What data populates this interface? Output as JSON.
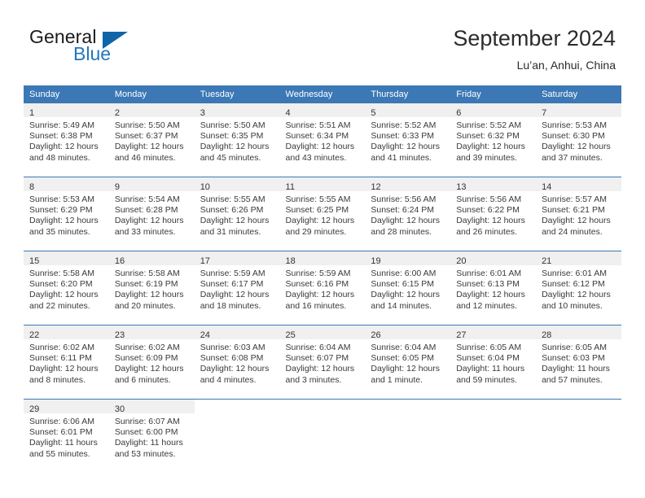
{
  "brand": {
    "name_part1": "General",
    "name_part2": "Blue",
    "logo_icon": "triangle-logo-icon"
  },
  "header": {
    "title": "September 2024",
    "location": "Lu’an, Anhui, China"
  },
  "calendar": {
    "weekday_headers": [
      "Sunday",
      "Monday",
      "Tuesday",
      "Wednesday",
      "Thursday",
      "Friday",
      "Saturday"
    ],
    "accent_color": "#3b78b5",
    "daynum_band_color": "#f0f0f0",
    "weeks": [
      [
        {
          "day": "1",
          "sunrise": "Sunrise: 5:49 AM",
          "sunset": "Sunset: 6:38 PM",
          "daylight1": "Daylight: 12 hours",
          "daylight2": "and 48 minutes."
        },
        {
          "day": "2",
          "sunrise": "Sunrise: 5:50 AM",
          "sunset": "Sunset: 6:37 PM",
          "daylight1": "Daylight: 12 hours",
          "daylight2": "and 46 minutes."
        },
        {
          "day": "3",
          "sunrise": "Sunrise: 5:50 AM",
          "sunset": "Sunset: 6:35 PM",
          "daylight1": "Daylight: 12 hours",
          "daylight2": "and 45 minutes."
        },
        {
          "day": "4",
          "sunrise": "Sunrise: 5:51 AM",
          "sunset": "Sunset: 6:34 PM",
          "daylight1": "Daylight: 12 hours",
          "daylight2": "and 43 minutes."
        },
        {
          "day": "5",
          "sunrise": "Sunrise: 5:52 AM",
          "sunset": "Sunset: 6:33 PM",
          "daylight1": "Daylight: 12 hours",
          "daylight2": "and 41 minutes."
        },
        {
          "day": "6",
          "sunrise": "Sunrise: 5:52 AM",
          "sunset": "Sunset: 6:32 PM",
          "daylight1": "Daylight: 12 hours",
          "daylight2": "and 39 minutes."
        },
        {
          "day": "7",
          "sunrise": "Sunrise: 5:53 AM",
          "sunset": "Sunset: 6:30 PM",
          "daylight1": "Daylight: 12 hours",
          "daylight2": "and 37 minutes."
        }
      ],
      [
        {
          "day": "8",
          "sunrise": "Sunrise: 5:53 AM",
          "sunset": "Sunset: 6:29 PM",
          "daylight1": "Daylight: 12 hours",
          "daylight2": "and 35 minutes."
        },
        {
          "day": "9",
          "sunrise": "Sunrise: 5:54 AM",
          "sunset": "Sunset: 6:28 PM",
          "daylight1": "Daylight: 12 hours",
          "daylight2": "and 33 minutes."
        },
        {
          "day": "10",
          "sunrise": "Sunrise: 5:55 AM",
          "sunset": "Sunset: 6:26 PM",
          "daylight1": "Daylight: 12 hours",
          "daylight2": "and 31 minutes."
        },
        {
          "day": "11",
          "sunrise": "Sunrise: 5:55 AM",
          "sunset": "Sunset: 6:25 PM",
          "daylight1": "Daylight: 12 hours",
          "daylight2": "and 29 minutes."
        },
        {
          "day": "12",
          "sunrise": "Sunrise: 5:56 AM",
          "sunset": "Sunset: 6:24 PM",
          "daylight1": "Daylight: 12 hours",
          "daylight2": "and 28 minutes."
        },
        {
          "day": "13",
          "sunrise": "Sunrise: 5:56 AM",
          "sunset": "Sunset: 6:22 PM",
          "daylight1": "Daylight: 12 hours",
          "daylight2": "and 26 minutes."
        },
        {
          "day": "14",
          "sunrise": "Sunrise: 5:57 AM",
          "sunset": "Sunset: 6:21 PM",
          "daylight1": "Daylight: 12 hours",
          "daylight2": "and 24 minutes."
        }
      ],
      [
        {
          "day": "15",
          "sunrise": "Sunrise: 5:58 AM",
          "sunset": "Sunset: 6:20 PM",
          "daylight1": "Daylight: 12 hours",
          "daylight2": "and 22 minutes."
        },
        {
          "day": "16",
          "sunrise": "Sunrise: 5:58 AM",
          "sunset": "Sunset: 6:19 PM",
          "daylight1": "Daylight: 12 hours",
          "daylight2": "and 20 minutes."
        },
        {
          "day": "17",
          "sunrise": "Sunrise: 5:59 AM",
          "sunset": "Sunset: 6:17 PM",
          "daylight1": "Daylight: 12 hours",
          "daylight2": "and 18 minutes."
        },
        {
          "day": "18",
          "sunrise": "Sunrise: 5:59 AM",
          "sunset": "Sunset: 6:16 PM",
          "daylight1": "Daylight: 12 hours",
          "daylight2": "and 16 minutes."
        },
        {
          "day": "19",
          "sunrise": "Sunrise: 6:00 AM",
          "sunset": "Sunset: 6:15 PM",
          "daylight1": "Daylight: 12 hours",
          "daylight2": "and 14 minutes."
        },
        {
          "day": "20",
          "sunrise": "Sunrise: 6:01 AM",
          "sunset": "Sunset: 6:13 PM",
          "daylight1": "Daylight: 12 hours",
          "daylight2": "and 12 minutes."
        },
        {
          "day": "21",
          "sunrise": "Sunrise: 6:01 AM",
          "sunset": "Sunset: 6:12 PM",
          "daylight1": "Daylight: 12 hours",
          "daylight2": "and 10 minutes."
        }
      ],
      [
        {
          "day": "22",
          "sunrise": "Sunrise: 6:02 AM",
          "sunset": "Sunset: 6:11 PM",
          "daylight1": "Daylight: 12 hours",
          "daylight2": "and 8 minutes."
        },
        {
          "day": "23",
          "sunrise": "Sunrise: 6:02 AM",
          "sunset": "Sunset: 6:09 PM",
          "daylight1": "Daylight: 12 hours",
          "daylight2": "and 6 minutes."
        },
        {
          "day": "24",
          "sunrise": "Sunrise: 6:03 AM",
          "sunset": "Sunset: 6:08 PM",
          "daylight1": "Daylight: 12 hours",
          "daylight2": "and 4 minutes."
        },
        {
          "day": "25",
          "sunrise": "Sunrise: 6:04 AM",
          "sunset": "Sunset: 6:07 PM",
          "daylight1": "Daylight: 12 hours",
          "daylight2": "and 3 minutes."
        },
        {
          "day": "26",
          "sunrise": "Sunrise: 6:04 AM",
          "sunset": "Sunset: 6:05 PM",
          "daylight1": "Daylight: 12 hours",
          "daylight2": "and 1 minute."
        },
        {
          "day": "27",
          "sunrise": "Sunrise: 6:05 AM",
          "sunset": "Sunset: 6:04 PM",
          "daylight1": "Daylight: 11 hours",
          "daylight2": "and 59 minutes."
        },
        {
          "day": "28",
          "sunrise": "Sunrise: 6:05 AM",
          "sunset": "Sunset: 6:03 PM",
          "daylight1": "Daylight: 11 hours",
          "daylight2": "and 57 minutes."
        }
      ],
      [
        {
          "day": "29",
          "sunrise": "Sunrise: 6:06 AM",
          "sunset": "Sunset: 6:01 PM",
          "daylight1": "Daylight: 11 hours",
          "daylight2": "and 55 minutes."
        },
        {
          "day": "30",
          "sunrise": "Sunrise: 6:07 AM",
          "sunset": "Sunset: 6:00 PM",
          "daylight1": "Daylight: 11 hours",
          "daylight2": "and 53 minutes."
        },
        {
          "day": "",
          "sunrise": "",
          "sunset": "",
          "daylight1": "",
          "daylight2": ""
        },
        {
          "day": "",
          "sunrise": "",
          "sunset": "",
          "daylight1": "",
          "daylight2": ""
        },
        {
          "day": "",
          "sunrise": "",
          "sunset": "",
          "daylight1": "",
          "daylight2": ""
        },
        {
          "day": "",
          "sunrise": "",
          "sunset": "",
          "daylight1": "",
          "daylight2": ""
        },
        {
          "day": "",
          "sunrise": "",
          "sunset": "",
          "daylight1": "",
          "daylight2": ""
        }
      ]
    ]
  }
}
